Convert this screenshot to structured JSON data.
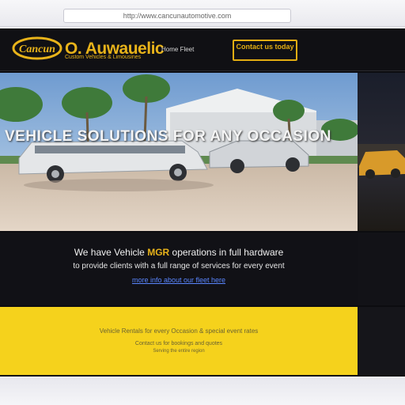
{
  "browser": {
    "url": "http://www.cancunautomotive.com"
  },
  "header": {
    "logo_text": "Cancun",
    "title": "O. Auwauelic",
    "tagline": "Custom Vehicles & Limousines",
    "top_links": "Home  Fleet",
    "cta_label": "Contact us today",
    "accent_color": "#e8b31a"
  },
  "hero": {
    "caption": "VEHICLE SOLUTIONS FOR ANY OCCASION"
  },
  "intro": {
    "line1_start": "We have Vehicle ",
    "line1_highlight": "MGR",
    "line1_end": " operations in full hardware",
    "line2": "to provide clients with a full range of services for every event",
    "link_text": "more info about our fleet here"
  },
  "footer_block": {
    "line1": "Vehicle Rentals for every Occasion & special event rates",
    "line2": "Contact us for bookings and quotes",
    "line3": "Serving the entire region"
  }
}
